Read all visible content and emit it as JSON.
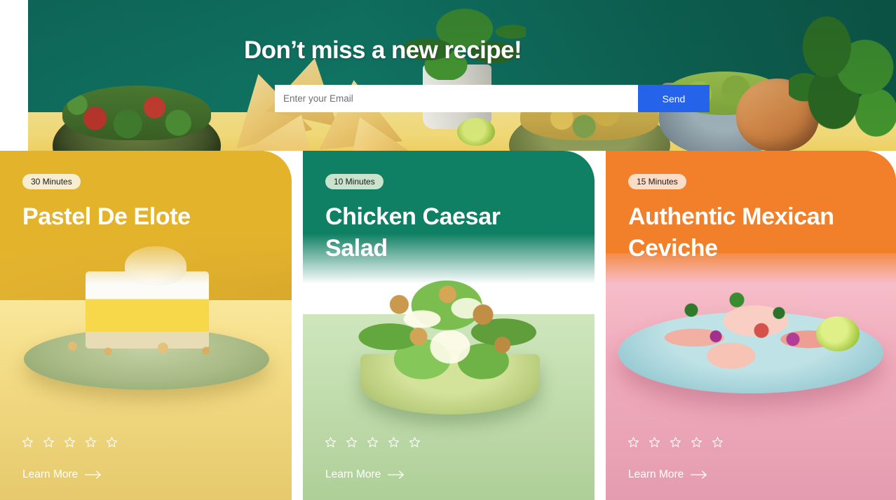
{
  "newsletter": {
    "title": "Don’t miss a new recipe!",
    "email_placeholder": "Enter your Email",
    "email_value": "",
    "send_label": "Send",
    "send_button_color": "#2563eb"
  },
  "cards": [
    {
      "badge": "30 Minutes",
      "title": "Pastel De Elote",
      "learn_more": "Learn More",
      "rating": 0,
      "max_rating": 5,
      "accent_color": "#e3b32c",
      "badge_color": "#f7eed2"
    },
    {
      "badge": "10 Minutes",
      "title": "Chicken Caesar Salad",
      "learn_more": "Learn More",
      "rating": 0,
      "max_rating": 5,
      "accent_color": "#0f8063",
      "badge_color": "#c9e3cc"
    },
    {
      "badge": "15 Minutes",
      "title": "Authentic Mexican Ceviche",
      "learn_more": "Learn More",
      "rating": 0,
      "max_rating": 5,
      "accent_color": "#f2802a",
      "badge_color": "#fbdcc6"
    }
  ],
  "icons": {
    "star": "star-outline-icon",
    "arrow": "arrow-right-icon"
  }
}
